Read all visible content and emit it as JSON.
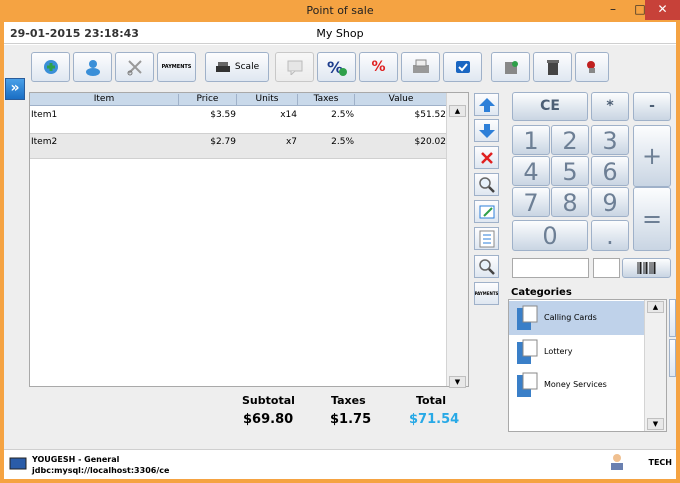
{
  "window": {
    "title": "Point of sale",
    "minimize": "–",
    "maximize": "□",
    "close": "✕"
  },
  "header": {
    "datetime": "29-01-2015 23:18:43",
    "shop_name": "My Shop"
  },
  "toolbar": {
    "payments_label": "PAYMENTS",
    "scale_label": "Scale",
    "percent_label": "%",
    "buttons": [
      {
        "name": "customer-add-icon",
        "color": "#3a8fd8"
      },
      {
        "name": "customer-icon",
        "color": "#3a8fd8"
      },
      {
        "name": "scissors-icon",
        "color": "#888888"
      },
      {
        "name": "payments-icon"
      },
      {
        "name": "scale-icon"
      },
      {
        "name": "notes-icon",
        "disabled": true
      },
      {
        "name": "discount-add-icon",
        "color": "#1c3c8c"
      },
      {
        "name": "percent-icon",
        "color": "#e02020"
      },
      {
        "name": "printer-icon"
      },
      {
        "name": "sync-icon",
        "color": "#1a66c2"
      },
      {
        "name": "tools-icon"
      },
      {
        "name": "trash-icon"
      },
      {
        "name": "user-pin-icon",
        "color": "#c02020"
      }
    ]
  },
  "side_toggle": "»",
  "ticket": {
    "columns": [
      "Item",
      "Price",
      "Units",
      "Taxes",
      "Value"
    ],
    "rows": [
      {
        "item": "Item1",
        "price": "$3.59",
        "units": "x14",
        "taxes": "2.5%",
        "value": "$51.52",
        "selected": false
      },
      {
        "item": "Item2",
        "price": "$2.79",
        "units": "x7",
        "taxes": "2.5%",
        "value": "$20.02",
        "selected": true
      }
    ],
    "scroll_up": "▲",
    "scroll_down": "▼"
  },
  "edit_buttons": {
    "up": "up-arrow-icon",
    "down": "down-arrow-icon",
    "delete": "delete-x-icon",
    "search": "search-icon",
    "edit": "edit-line-icon",
    "attributes": "list-icon",
    "search_product": "search-product-icon",
    "payments_label": "PAYMENTS"
  },
  "totals": {
    "subtotal_label": "Subtotal",
    "taxes_label": "Taxes",
    "total_label": "Total",
    "subtotal": "$69.80",
    "taxes": "$1.75",
    "total": "$71.54",
    "total_color": "#28a9e6"
  },
  "keypad": {
    "ce": "CE",
    "multiply": "*",
    "minus": "-",
    "plus": "+",
    "equals": "=",
    "dot": ".",
    "digits": [
      "1",
      "2",
      "3",
      "4",
      "5",
      "6",
      "7",
      "8",
      "9",
      "0"
    ]
  },
  "categories": {
    "title": "Categories",
    "items": [
      {
        "label": "Calling Cards",
        "selected": true
      },
      {
        "label": "Lottery",
        "selected": false
      },
      {
        "label": "Money Services",
        "selected": false
      }
    ],
    "scroll_up": "▲",
    "scroll_down": "▼"
  },
  "footer": {
    "user": "YOUGESH - General",
    "db": "jdbc:mysql://localhost:3306/ce",
    "role": "TECH"
  }
}
